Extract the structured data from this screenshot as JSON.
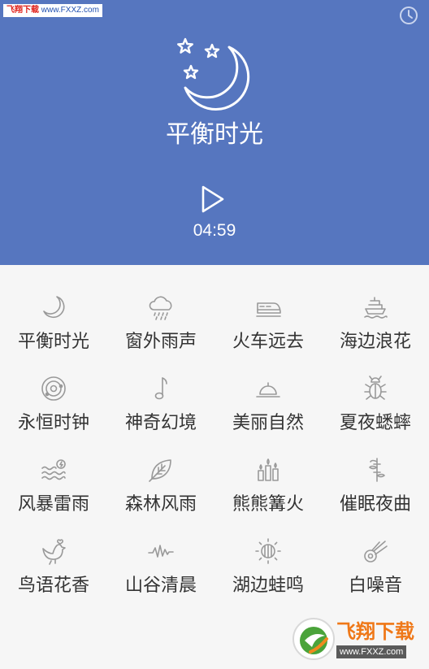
{
  "watermark_top": {
    "label": "飞翔下载",
    "url": "www.FXXZ.com"
  },
  "header": {
    "title": "平衡时光",
    "time": "04:59",
    "background": "#5676bf"
  },
  "sounds": [
    {
      "label": "平衡时光",
      "icon": "moon-icon"
    },
    {
      "label": "窗外雨声",
      "icon": "rain-cloud-icon"
    },
    {
      "label": "火车远去",
      "icon": "train-icon"
    },
    {
      "label": "海边浪花",
      "icon": "ship-icon"
    },
    {
      "label": "永恒时钟",
      "icon": "orbit-icon"
    },
    {
      "label": "神奇幻境",
      "icon": "music-note-icon"
    },
    {
      "label": "美丽自然",
      "icon": "sunset-icon"
    },
    {
      "label": "夏夜蟋蟀",
      "icon": "bug-icon"
    },
    {
      "label": "风暴雷雨",
      "icon": "storm-waves-icon"
    },
    {
      "label": "森林风雨",
      "icon": "leaf-icon"
    },
    {
      "label": "熊熊篝火",
      "icon": "candles-icon"
    },
    {
      "label": "催眠夜曲",
      "icon": "bamboo-icon"
    },
    {
      "label": "鸟语花香",
      "icon": "bird-icon"
    },
    {
      "label": "山谷清晨",
      "icon": "waveform-icon"
    },
    {
      "label": "湖边蛙鸣",
      "icon": "sun-icon"
    },
    {
      "label": "白噪音",
      "icon": "comet-icon"
    }
  ],
  "watermark_bottom": {
    "brand": "飞翔下载",
    "url": "www.FXXZ.com"
  },
  "colors": {
    "accent": "#5676bf",
    "icon": "#999999",
    "label": "#333333",
    "brand": "#ef7818"
  }
}
